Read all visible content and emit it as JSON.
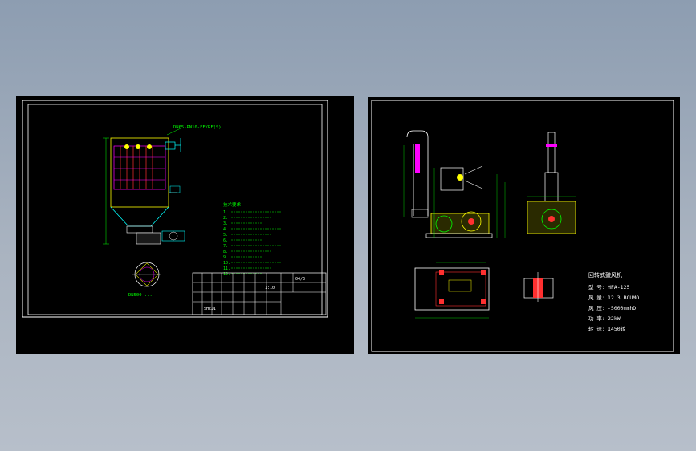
{
  "colors": {
    "background": "#9aa7b8",
    "sheet": "#000000",
    "frame": "#ffffff",
    "green": "#00ff00",
    "yellow": "#ffff00",
    "cyan": "#00ffff",
    "magenta": "#ff00ff",
    "red": "#ff3030"
  },
  "left_sheet": {
    "pipe_label": "DN65-PN10-FF/RF(S)",
    "section_label": "DN500 ...",
    "notes_title": "技术要求:",
    "notes": [
      "1.",
      "2.",
      "3.",
      "4.",
      "5.",
      "6.",
      "7.",
      "8.",
      "9.",
      "10.",
      "11.",
      "12."
    ],
    "title_block": {
      "part_no": "04/3",
      "scale": "1:10",
      "drawing_no": "SHEJI"
    }
  },
  "right_sheet": {
    "fan_title": "回转式鼓风机",
    "specs": [
      {
        "key": "型 号:",
        "value": "HFA-125"
      },
      {
        "key": "风 量:",
        "value": "12.3 BCUMO"
      },
      {
        "key": "风 压:",
        "value": "-5000mmhD"
      },
      {
        "key": "功 率:",
        "value": "22kW"
      },
      {
        "key": "转 速:",
        "value": "1450转"
      }
    ]
  }
}
